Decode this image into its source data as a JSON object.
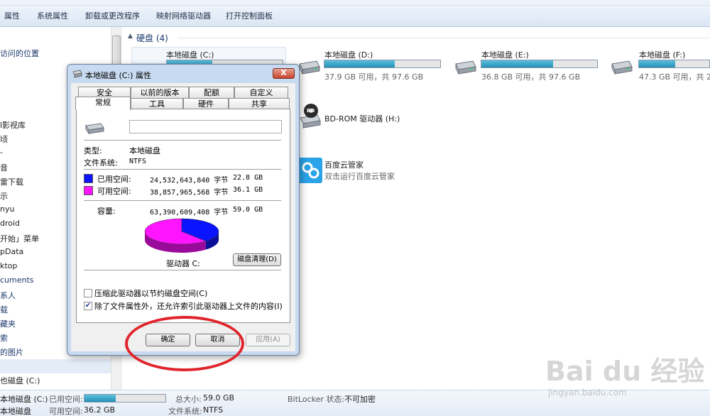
{
  "toolbar": {
    "items": [
      "属性",
      "系统属性",
      "卸载或更改程序",
      "映射网络驱动器",
      "打开控制面板"
    ]
  },
  "sidebar": {
    "items": [
      {
        "label": "访问的位置",
        "kind": "link"
      },
      {
        "label": "l影视库",
        "kind": "dark"
      },
      {
        "label": "顷",
        "kind": "dark"
      },
      {
        "label": "-",
        "kind": "dark"
      },
      {
        "label": "音",
        "kind": "dark"
      },
      {
        "label": "雷下载",
        "kind": "dark"
      },
      {
        "label": "示",
        "kind": "dark"
      },
      {
        "label": "nyu",
        "kind": "dark"
      },
      {
        "label": "droid",
        "kind": "dark"
      },
      {
        "label": "开始」菜单",
        "kind": "dark"
      },
      {
        "label": "pData",
        "kind": "dark"
      },
      {
        "label": "ktop",
        "kind": "dark"
      },
      {
        "label": "cuments",
        "kind": "link"
      },
      {
        "label": "系人",
        "kind": "link"
      },
      {
        "label": "载",
        "kind": "link"
      },
      {
        "label": "藏夹",
        "kind": "link"
      },
      {
        "label": "索",
        "kind": "link"
      },
      {
        "label": "的图片",
        "kind": "link"
      },
      {
        "label": "几",
        "kind": "dark"
      },
      {
        "label": "也磁盘 (C:)",
        "kind": "dark"
      }
    ]
  },
  "content": {
    "group_header": "硬盘 (4)",
    "drives": [
      {
        "name": "本地磁盘 (C:)",
        "info": "",
        "fill_pct": 39
      },
      {
        "name": "本地磁盘 (D:)",
        "info": "37.9 GB 可用，共 97.6 GB",
        "fill_pct": 61
      },
      {
        "name": "本地磁盘 (E:)",
        "info": "36.8 GB 可用，共 97.6 GB",
        "fill_pct": 62
      },
      {
        "name": "本地磁盘 (F:)",
        "info": "47.3 GB 可用，共 21",
        "fill_pct": 52
      }
    ],
    "bdrom": {
      "name": "BD-ROM 驱动器 (H:)",
      "badge": "BD"
    },
    "baidu": {
      "name": "百度云管家",
      "subtitle": "双击运行百度云管家"
    }
  },
  "statusbar": {
    "drive_name": "本地磁盘 (C:)",
    "drive_type": "本地磁盘",
    "used_label": "已用空间:",
    "free_label": "可用空间:",
    "free_value": "36.2 GB",
    "total_label": "总大小:",
    "total_value": "59.0 GB",
    "fs_label": "文件系统:",
    "fs_value": "NTFS",
    "bitlocker_label": "BitLocker 状态:",
    "bitlocker_value": "不可加密",
    "used_fill_pct": 39
  },
  "dialog": {
    "title": "本地磁盘 (C:) 属性",
    "close": "X",
    "tabs_row1": [
      "安全",
      "以前的版本",
      "配额",
      "自定义"
    ],
    "tabs_row2": [
      "常规",
      "工具",
      "硬件",
      "共享"
    ],
    "active_tab": "常规",
    "name_value": "",
    "type_label": "类型:",
    "type_value": "本地磁盘",
    "fs_label": "文件系统:",
    "fs_value": "NTFS",
    "used_label": "已用空间:",
    "used_bytes": "24,532,643,840 字节",
    "used_gb": "22.8 GB",
    "free_label": "可用空间:",
    "free_bytes": "38,857,965,568 字节",
    "free_gb": "36.1 GB",
    "capacity_label": "容量:",
    "capacity_bytes": "63,390,609,408 字节",
    "capacity_gb": "59.0 GB",
    "drive_label": "驱动器 C:",
    "cleanup_button": "磁盘清理(D)",
    "compress_label": "压缩此驱动器以节约磁盘空间(C)",
    "compress_checked": false,
    "index_label": "除了文件属性外，还允许索引此驱动器上文件的内容(I)",
    "index_checked": true,
    "ok_button": "确定",
    "cancel_button": "取消",
    "apply_button": "应用(A)",
    "used_color": "#0a14ff",
    "free_color": "#ff14ff",
    "used_fraction": 0.387
  },
  "watermark": {
    "logo": "Bai du 经验",
    "url": "jingyan.baidu.com"
  }
}
